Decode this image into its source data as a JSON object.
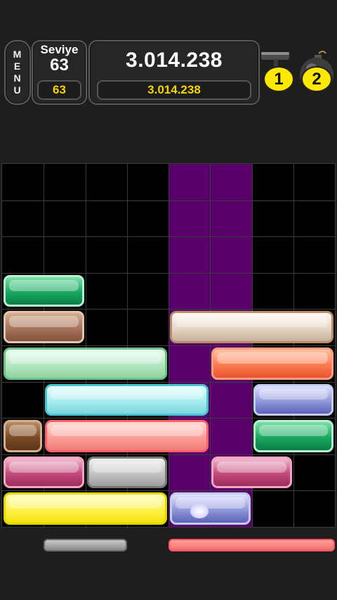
{
  "hud": {
    "menu_label": "MENU",
    "level_label": "Seviye",
    "level_value": "63",
    "level_sub_value": "63",
    "score_value": "3.014.238",
    "score_sub_value": "3.014.238"
  },
  "powerups": [
    {
      "icon": "hammer-icon",
      "count": "1"
    },
    {
      "icon": "bomb-icon",
      "count": "2"
    }
  ],
  "board": {
    "columns": 8,
    "rows": 10,
    "highlighted_columns": [
      4,
      5
    ],
    "colors": {
      "background": "#000000",
      "highlight": "#5a006b",
      "grid": "#3c3c3c"
    },
    "blocks": [
      {
        "row": 3,
        "col": 0,
        "len": 2,
        "color": "green"
      },
      {
        "row": 4,
        "col": 0,
        "len": 2,
        "color": "brown"
      },
      {
        "row": 4,
        "col": 4,
        "len": 4,
        "color": "cream"
      },
      {
        "row": 5,
        "col": 0,
        "len": 4,
        "color": "lightgreen"
      },
      {
        "row": 5,
        "col": 5,
        "len": 3,
        "color": "orange"
      },
      {
        "row": 6,
        "col": 1,
        "len": 4,
        "color": "cyan"
      },
      {
        "row": 6,
        "col": 6,
        "len": 2,
        "color": "blue"
      },
      {
        "row": 7,
        "col": 0,
        "len": 1,
        "color": "brown-dark"
      },
      {
        "row": 7,
        "col": 1,
        "len": 4,
        "color": "salmon"
      },
      {
        "row": 7,
        "col": 6,
        "len": 2,
        "color": "green"
      },
      {
        "row": 8,
        "col": 0,
        "len": 2,
        "color": "magenta"
      },
      {
        "row": 8,
        "col": 2,
        "len": 2,
        "color": "grey"
      },
      {
        "row": 8,
        "col": 5,
        "len": 2,
        "color": "magenta"
      },
      {
        "row": 9,
        "col": 0,
        "len": 4,
        "color": "yellow"
      },
      {
        "row": 9,
        "col": 4,
        "len": 2,
        "color": "blue"
      }
    ]
  },
  "next_row": [
    {
      "col": 1,
      "len": 2,
      "color": "grey"
    },
    {
      "col": 4,
      "len": 4,
      "color": "salmon"
    }
  ]
}
